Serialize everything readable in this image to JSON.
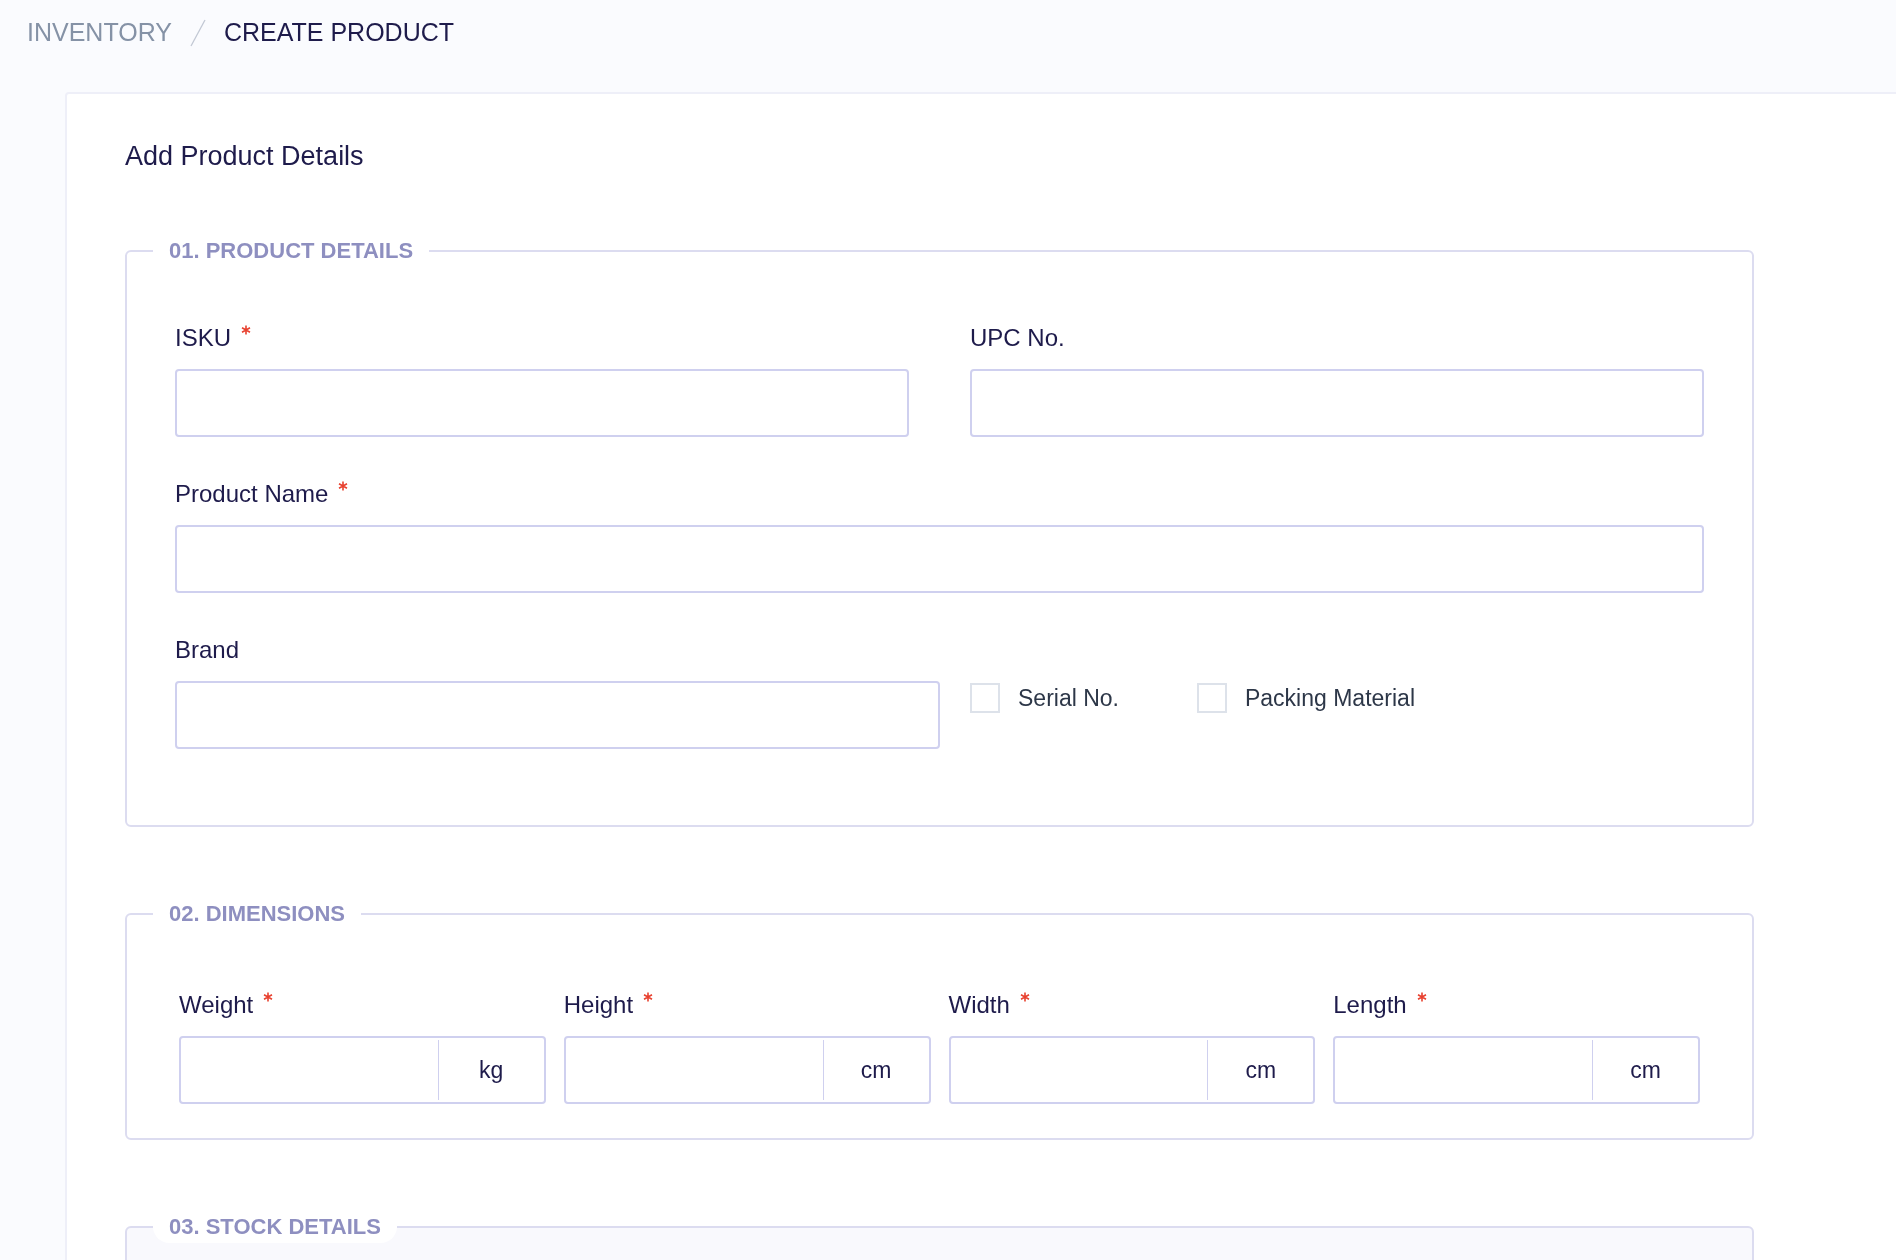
{
  "breadcrumb": [
    {
      "label": "INVENTORY",
      "selected": false
    },
    {
      "label": "CREATE PRODUCT",
      "selected": true
    }
  ],
  "card": {
    "title": "Add Product Details"
  },
  "sections": [
    {
      "title": "01. PRODUCT DETAILS",
      "rows": [
        {
          "fields": [
            {
              "kind": "text",
              "label": "ISKU",
              "required": true
            },
            {
              "kind": "text",
              "label": "UPC No.",
              "required": false
            }
          ]
        },
        {
          "fields": [
            {
              "kind": "text",
              "label": "Product Name",
              "required": true
            }
          ]
        },
        {
          "fields": [
            {
              "kind": "text",
              "label": "Brand",
              "required": false
            },
            {
              "kind": "checkbox",
              "label": "Serial No.",
              "checked": false
            },
            {
              "kind": "checkbox",
              "label": "Packing Material",
              "checked": false
            }
          ]
        }
      ]
    },
    {
      "title": "02. DIMENSIONS",
      "rows": [
        {
          "fields": [
            {
              "kind": "unit",
              "label": "Weight",
              "required": true,
              "unit": "kg"
            },
            {
              "kind": "unit",
              "label": "Height",
              "required": true,
              "unit": "cm"
            },
            {
              "kind": "unit",
              "label": "Width",
              "required": true,
              "unit": "cm"
            },
            {
              "kind": "unit",
              "label": "Length",
              "required": true,
              "unit": "cm"
            }
          ]
        }
      ]
    },
    {
      "title": "03. STOCK DETAILS"
    }
  ]
}
